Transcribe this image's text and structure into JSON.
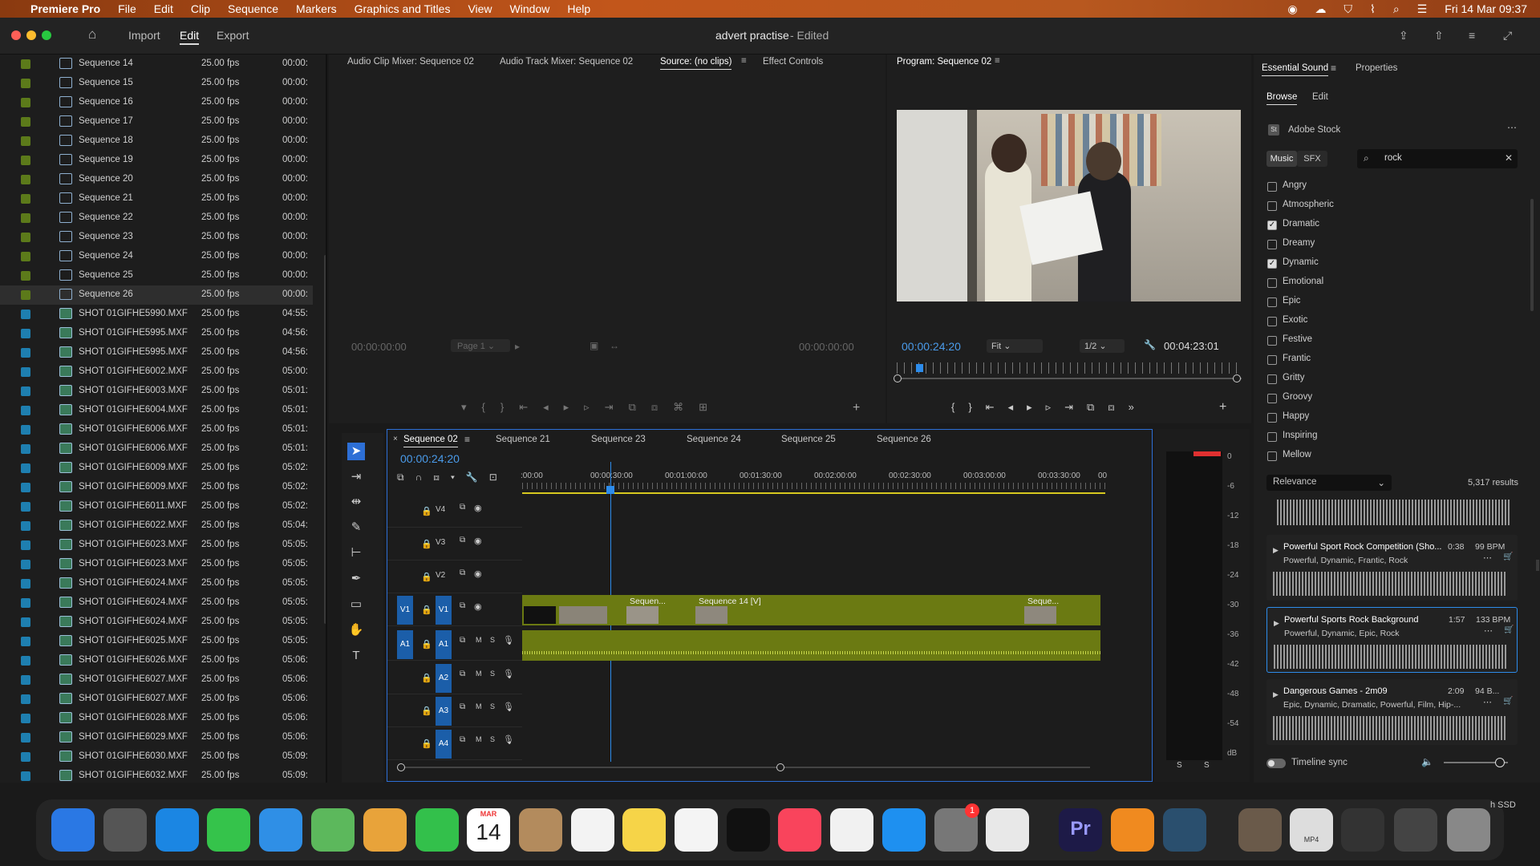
{
  "menubar": {
    "app": "Premiere Pro",
    "items": [
      "File",
      "Edit",
      "Clip",
      "Sequence",
      "Markers",
      "Graphics and Titles",
      "View",
      "Window",
      "Help"
    ],
    "datetime": "Fri 14 Mar  09:37"
  },
  "titlebar": {
    "tabs": [
      "Import",
      "Edit",
      "Export"
    ],
    "title": "advert practise",
    "edited": "- Edited"
  },
  "project": {
    "rows": [
      {
        "name": "Sequence 14",
        "fps": "25.00 fps",
        "dur": "00:00:",
        "kind": "seq"
      },
      {
        "name": "Sequence 15",
        "fps": "25.00 fps",
        "dur": "00:00:",
        "kind": "seq"
      },
      {
        "name": "Sequence 16",
        "fps": "25.00 fps",
        "dur": "00:00:",
        "kind": "seq"
      },
      {
        "name": "Sequence 17",
        "fps": "25.00 fps",
        "dur": "00:00:",
        "kind": "seq"
      },
      {
        "name": "Sequence 18",
        "fps": "25.00 fps",
        "dur": "00:00:",
        "kind": "seq"
      },
      {
        "name": "Sequence 19",
        "fps": "25.00 fps",
        "dur": "00:00:",
        "kind": "seq"
      },
      {
        "name": "Sequence 20",
        "fps": "25.00 fps",
        "dur": "00:00:",
        "kind": "seq"
      },
      {
        "name": "Sequence 21",
        "fps": "25.00 fps",
        "dur": "00:00:",
        "kind": "seq"
      },
      {
        "name": "Sequence 22",
        "fps": "25.00 fps",
        "dur": "00:00:",
        "kind": "seq"
      },
      {
        "name": "Sequence 23",
        "fps": "25.00 fps",
        "dur": "00:00:",
        "kind": "seq"
      },
      {
        "name": "Sequence 24",
        "fps": "25.00 fps",
        "dur": "00:00:",
        "kind": "seq"
      },
      {
        "name": "Sequence 25",
        "fps": "25.00 fps",
        "dur": "00:00:",
        "kind": "seq"
      },
      {
        "name": "Sequence 26",
        "fps": "25.00 fps",
        "dur": "00:00:",
        "kind": "seq"
      },
      {
        "name": "SHOT 01GIFHE5990.MXF",
        "fps": "25.00 fps",
        "dur": "04:55:",
        "kind": "clip"
      },
      {
        "name": "SHOT 01GIFHE5995.MXF",
        "fps": "25.00 fps",
        "dur": "04:56:",
        "kind": "clip"
      },
      {
        "name": "SHOT 01GIFHE5995.MXF",
        "fps": "25.00 fps",
        "dur": "04:56:",
        "kind": "clip"
      },
      {
        "name": "SHOT 01GIFHE6002.MXF",
        "fps": "25.00 fps",
        "dur": "05:00:",
        "kind": "clip"
      },
      {
        "name": "SHOT 01GIFHE6003.MXF",
        "fps": "25.00 fps",
        "dur": "05:01:",
        "kind": "clip"
      },
      {
        "name": "SHOT 01GIFHE6004.MXF",
        "fps": "25.00 fps",
        "dur": "05:01:",
        "kind": "clip"
      },
      {
        "name": "SHOT 01GIFHE6006.MXF",
        "fps": "25.00 fps",
        "dur": "05:01:",
        "kind": "clip"
      },
      {
        "name": "SHOT 01GIFHE6006.MXF",
        "fps": "25.00 fps",
        "dur": "05:01:",
        "kind": "clip"
      },
      {
        "name": "SHOT 01GIFHE6009.MXF",
        "fps": "25.00 fps",
        "dur": "05:02:",
        "kind": "clip"
      },
      {
        "name": "SHOT 01GIFHE6009.MXF",
        "fps": "25.00 fps",
        "dur": "05:02:",
        "kind": "clip"
      },
      {
        "name": "SHOT 01GIFHE6011.MXF",
        "fps": "25.00 fps",
        "dur": "05:02:",
        "kind": "clip"
      },
      {
        "name": "SHOT 01GIFHE6022.MXF",
        "fps": "25.00 fps",
        "dur": "05:04:",
        "kind": "clip"
      },
      {
        "name": "SHOT 01GIFHE6023.MXF",
        "fps": "25.00 fps",
        "dur": "05:05:",
        "kind": "clip"
      },
      {
        "name": "SHOT 01GIFHE6023.MXF",
        "fps": "25.00 fps",
        "dur": "05:05:",
        "kind": "clip"
      },
      {
        "name": "SHOT 01GIFHE6024.MXF",
        "fps": "25.00 fps",
        "dur": "05:05:",
        "kind": "clip"
      },
      {
        "name": "SHOT 01GIFHE6024.MXF",
        "fps": "25.00 fps",
        "dur": "05:05:",
        "kind": "clip"
      },
      {
        "name": "SHOT 01GIFHE6024.MXF",
        "fps": "25.00 fps",
        "dur": "05:05:",
        "kind": "clip"
      },
      {
        "name": "SHOT 01GIFHE6025.MXF",
        "fps": "25.00 fps",
        "dur": "05:05:",
        "kind": "clip"
      },
      {
        "name": "SHOT 01GIFHE6026.MXF",
        "fps": "25.00 fps",
        "dur": "05:06:",
        "kind": "clip"
      },
      {
        "name": "SHOT 01GIFHE6027.MXF",
        "fps": "25.00 fps",
        "dur": "05:06:",
        "kind": "clip"
      },
      {
        "name": "SHOT 01GIFHE6027.MXF",
        "fps": "25.00 fps",
        "dur": "05:06:",
        "kind": "clip"
      },
      {
        "name": "SHOT 01GIFHE6028.MXF",
        "fps": "25.00 fps",
        "dur": "05:06:",
        "kind": "clip"
      },
      {
        "name": "SHOT 01GIFHE6029.MXF",
        "fps": "25.00 fps",
        "dur": "05:06:",
        "kind": "clip"
      },
      {
        "name": "SHOT 01GIFHE6030.MXF",
        "fps": "25.00 fps",
        "dur": "05:09:",
        "kind": "clip"
      },
      {
        "name": "SHOT 01GIFHE6032.MXF",
        "fps": "25.00 fps",
        "dur": "05:09:",
        "kind": "clip"
      }
    ]
  },
  "source": {
    "tabs": [
      "Audio Clip Mixer: Sequence 02",
      "Audio Track Mixer: Sequence 02",
      "Source: (no clips)",
      "Effect Controls"
    ],
    "tc_left": "00:00:00:00",
    "tc_right": "00:00:00:00",
    "page": "Page 1"
  },
  "program": {
    "title": "Program: Sequence 02",
    "tc": "00:00:24:20",
    "fit": "Fit",
    "res": "1/2",
    "duration": "00:04:23:01"
  },
  "timeline": {
    "tabs": [
      "Sequence 02",
      "Sequence 21",
      "Sequence 23",
      "Sequence 24",
      "Sequence 25",
      "Sequence 26"
    ],
    "tc": "00:00:24:20",
    "ruler": [
      ":00:00",
      "00:00:30:00",
      "00:01:00:00",
      "00:01:30:00",
      "00:02:00:00",
      "00:02:30:00",
      "00:03:00:00",
      "00:03:30:00",
      "00"
    ],
    "video_tracks": [
      "V4",
      "V3",
      "V2",
      "V1"
    ],
    "audio_tracks": [
      "A1",
      "A2",
      "A3",
      "A4"
    ],
    "src_v": "V1",
    "src_a": "A1",
    "mute": "M",
    "solo": "S",
    "clips": {
      "c1": "Sequen...",
      "c2": "Sequence 14 [V]",
      "c3": "Seque..."
    }
  },
  "meter": {
    "scale": [
      "0",
      "-6",
      "-12",
      "-18",
      "-24",
      "-30",
      "-36",
      "-42",
      "-48",
      "-54",
      "dB"
    ],
    "solo": [
      "S",
      "S"
    ]
  },
  "essential": {
    "tabs": [
      "Essential Sound",
      "Properties"
    ],
    "subtabs": [
      "Browse",
      "Edit"
    ],
    "stock": "Adobe Stock",
    "music": "Music",
    "sfx": "SFX",
    "search": "rock",
    "moods": [
      {
        "label": "Angry",
        "checked": false
      },
      {
        "label": "Atmospheric",
        "checked": false
      },
      {
        "label": "Dramatic",
        "checked": true
      },
      {
        "label": "Dreamy",
        "checked": false
      },
      {
        "label": "Dynamic",
        "checked": true
      },
      {
        "label": "Emotional",
        "checked": false
      },
      {
        "label": "Epic",
        "checked": false
      },
      {
        "label": "Exotic",
        "checked": false
      },
      {
        "label": "Festive",
        "checked": false
      },
      {
        "label": "Frantic",
        "checked": false
      },
      {
        "label": "Gritty",
        "checked": false
      },
      {
        "label": "Groovy",
        "checked": false
      },
      {
        "label": "Happy",
        "checked": false
      },
      {
        "label": "Inspiring",
        "checked": false
      },
      {
        "label": "Mellow",
        "checked": false
      }
    ],
    "sort": "Relevance",
    "results": "5,317 results",
    "tracks": [
      {
        "title": "Powerful Sport Rock Competition (Sho...",
        "dur": "0:38",
        "bpm": "99 BPM",
        "tags": "Powerful, Dynamic, Frantic, Rock"
      },
      {
        "title": "Powerful Sports Rock Background",
        "dur": "1:57",
        "bpm": "133 BPM",
        "tags": "Powerful, Dynamic, Epic, Rock"
      },
      {
        "title": "Dangerous Games - 2m09",
        "dur": "2:09",
        "bpm": "94 B...",
        "tags": "Epic, Dynamic, Dramatic, Powerful, Film, Hip-..."
      }
    ],
    "sync": "Timeline sync"
  },
  "dock": {
    "calendar_month": "MAR",
    "calendar_day": "14",
    "badge": "1",
    "pr": "Pr",
    "mp4": "MP4",
    "ssd": "h SSD"
  },
  "colors": {
    "accent": "#2d8ceb",
    "clip": "#6b7a12",
    "seqchip": "#5c7a1a",
    "clipchip": "#1e7fb0"
  }
}
